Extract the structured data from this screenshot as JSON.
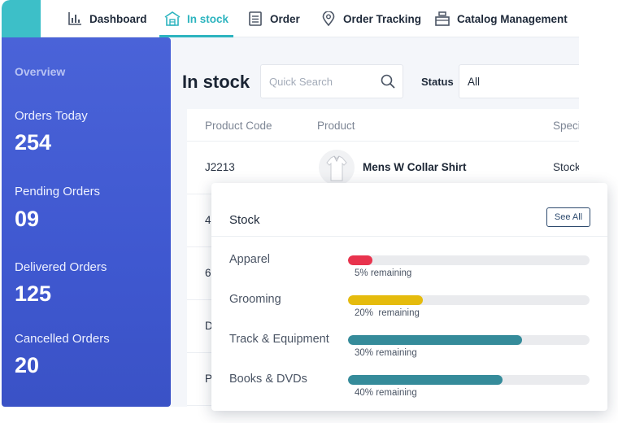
{
  "nav": {
    "items": [
      {
        "label": "Dashboard",
        "icon": "bar-chart-icon",
        "active": false
      },
      {
        "label": "In stock",
        "icon": "warehouse-icon",
        "active": true
      },
      {
        "label": "Order",
        "icon": "document-icon",
        "active": false
      },
      {
        "label": "Order Tracking",
        "icon": "location-pin-icon",
        "active": false
      },
      {
        "label": "Catalog Management",
        "icon": "catalog-box-icon",
        "active": false
      }
    ]
  },
  "page": {
    "title": "In stock",
    "search_placeholder": "Quick Search",
    "status_label": "Status",
    "status_value": "All"
  },
  "table": {
    "columns": [
      "Product Code",
      "Product",
      "Speci"
    ],
    "rows": [
      {
        "code": "J2213",
        "product": "Mens W Collar Shirt",
        "spec": "Stock"
      },
      {
        "code": "4",
        "product": "",
        "spec": ""
      },
      {
        "code": "6",
        "product": "",
        "spec": ""
      },
      {
        "code": "D",
        "product": "",
        "spec": ""
      },
      {
        "code": "P",
        "product": "",
        "spec": ""
      }
    ]
  },
  "sidebar": {
    "overview": "Overview",
    "stats": [
      {
        "label": "Orders Today",
        "value": "254"
      },
      {
        "label": "Pending Orders",
        "value": "09"
      },
      {
        "label": "Delivered Orders",
        "value": "125"
      },
      {
        "label": "Cancelled Orders",
        "value": "20"
      }
    ]
  },
  "stock_card": {
    "title": "Stock",
    "see_all": "See All",
    "categories": [
      {
        "label": "Apparel",
        "remaining_text": "5% remaining",
        "fill": 0.1,
        "color": "#e8334d"
      },
      {
        "label": "Grooming",
        "remaining_text": "20%  remaining",
        "fill": 0.31,
        "color": "#e5bb0d"
      },
      {
        "label": "Track & Equipment",
        "remaining_text": "30% remaining",
        "fill": 0.72,
        "color": "#358b9a"
      },
      {
        "label": "Books & DVDs",
        "remaining_text": "40% remaining",
        "fill": 0.64,
        "color": "#358b9a"
      }
    ]
  },
  "colors": {
    "accent": "#2db4bf",
    "sidebar": "#4a63d8",
    "teal_block": "#3dbfc8"
  }
}
